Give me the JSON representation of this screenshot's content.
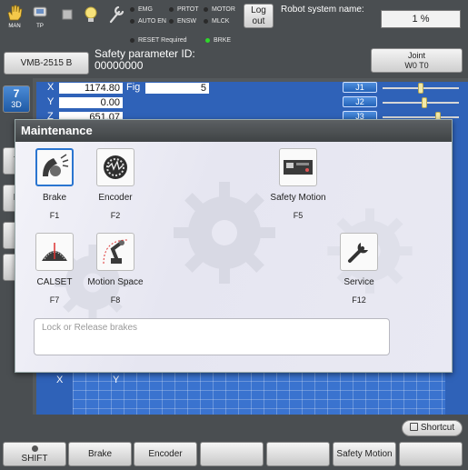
{
  "status_bar": {
    "mode_label": "MAN",
    "tp_label": "TP",
    "indicators": [
      {
        "label": "EMG",
        "on": false
      },
      {
        "label": "PRTOT",
        "on": false
      },
      {
        "label": "MOTOR",
        "on": false
      },
      {
        "label": "AUTO EN",
        "on": false
      },
      {
        "label": "ENSW",
        "on": false
      },
      {
        "label": "MLCK",
        "on": false
      },
      {
        "label": "RESET Required",
        "on": false
      },
      {
        "label": "BRKE",
        "on": true
      }
    ],
    "logout_label": "Log out",
    "robot_name_label": "Robot system name:",
    "progress_text": "1 %"
  },
  "header": {
    "model_button": "VMB-2515 B",
    "safety_param_label": "Safety parameter ID:",
    "safety_param_value": "00000000",
    "joint_button_line1": "Joint",
    "joint_button_line2": "W0 T0"
  },
  "left_tools": {
    "btn_3d": "3D",
    "items": [
      "T",
      "P",
      "",
      ""
    ]
  },
  "coords": {
    "x_label": "X",
    "x_value": "1174.80",
    "y_label": "Y",
    "y_value": "0.00",
    "z_label": "Z",
    "z_value": "651.07",
    "fig_label": "Fig",
    "fig_value": "5"
  },
  "joints": [
    {
      "label": "J1",
      "level": 0.5
    },
    {
      "label": "J2",
      "level": 0.55
    },
    {
      "label": "J3",
      "level": 0.74
    }
  ],
  "axes": {
    "x": "X",
    "y": "Y"
  },
  "dialog": {
    "title": "Maintenance",
    "functions": [
      {
        "name": "Brake",
        "key": "F1"
      },
      {
        "name": "Encoder",
        "key": "F2"
      },
      {
        "name": "Safety Motion",
        "key": "F5"
      },
      {
        "name": "CALSET",
        "key": "F7"
      },
      {
        "name": "Motion Space",
        "key": "F8"
      },
      {
        "name": "Service",
        "key": "F12"
      }
    ],
    "description": "Lock or Release brakes"
  },
  "bottom_bar": {
    "shortcut_label": "Shortcut",
    "fkeys": [
      "SHIFT",
      "Brake",
      "Encoder",
      "",
      "",
      "Safety Motion",
      ""
    ]
  }
}
